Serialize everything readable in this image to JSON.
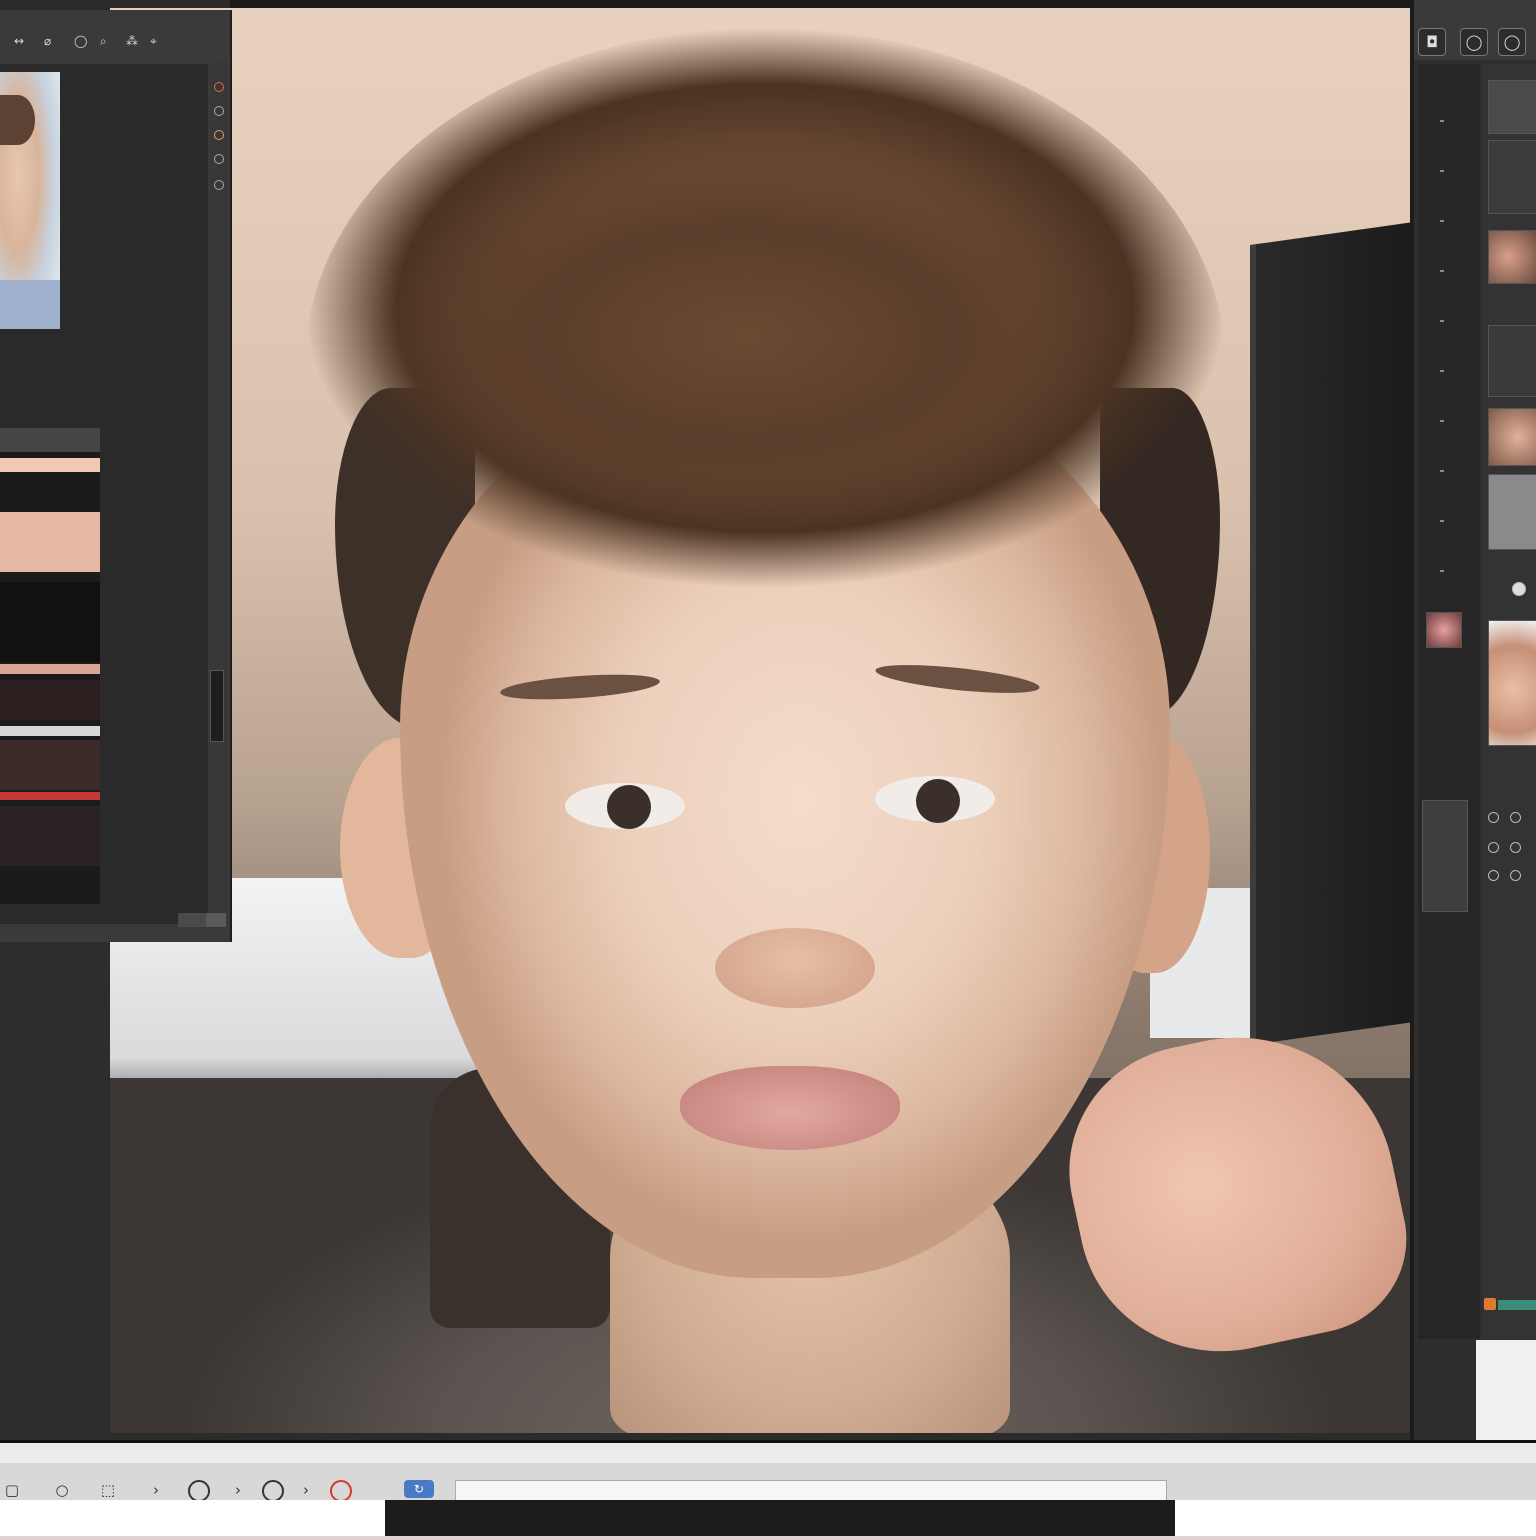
{
  "window": {
    "top_label": "",
    "right_top_label": "",
    "bottom_label": "",
    "bottom_label_2": ""
  },
  "left_panel": {
    "tools": [
      "↔",
      "⌀",
      "◯",
      "⌕",
      "⁂",
      "⌖"
    ],
    "thumb_caption": "",
    "footer_label": "",
    "lower_label": "",
    "list_rows": [
      {
        "color": "#f0c8b4"
      },
      {
        "color": "#1a1a1a"
      },
      {
        "color": "#e6b8a4"
      },
      {
        "color": "#111111"
      },
      {
        "color": "#d9a596"
      },
      {
        "color": "#2a1e1e"
      },
      {
        "color": "#c43a3a"
      }
    ]
  },
  "right_panel": {
    "buttons": [
      "◘",
      "◯",
      "◯"
    ],
    "tiles": [
      "hair-preview",
      "face-preview",
      "ear-preview",
      "face-preview-2",
      "profile-preview"
    ]
  },
  "bottom_bar": {
    "icons": [
      "▢",
      "○",
      "⬚",
      "›",
      "○",
      "◎",
      "›",
      "◎",
      "›"
    ],
    "button_label": "↻"
  },
  "colors": {
    "panel": "#3a3a3a",
    "panel_dark": "#262626",
    "accent_orange": "#e07a2e",
    "accent_teal": "#3c8c7a",
    "accent_blue": "#4a79c6",
    "accent_red": "#d43a2a"
  }
}
